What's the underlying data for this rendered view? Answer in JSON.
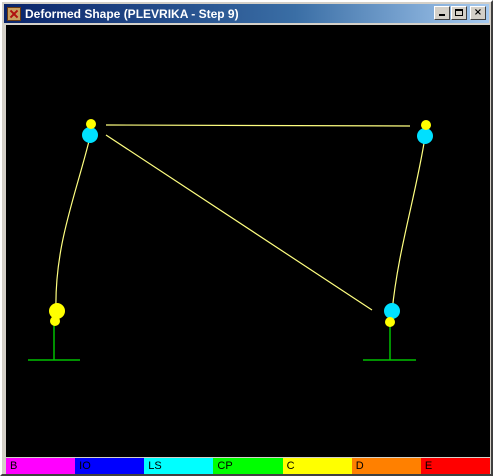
{
  "window": {
    "title": "Deformed Shape (PLEVRIKA - Step 9)",
    "controls": {
      "minimize": "minimize",
      "maximize": "maximize",
      "close": "×"
    }
  },
  "legend": [
    {
      "label": "B",
      "color": "#ff00ff"
    },
    {
      "label": "IO",
      "color": "#0000ff"
    },
    {
      "label": "LS",
      "color": "#00ffff"
    },
    {
      "label": "CP",
      "color": "#00ff00"
    },
    {
      "label": "C",
      "color": "#ffff00"
    },
    {
      "label": "D",
      "color": "#ff8000"
    },
    {
      "label": "E",
      "color": "#ff0000"
    }
  ],
  "colors": {
    "canvas_background": "#000000",
    "member_line": "#ffff80",
    "support_line": "#00c000",
    "hinge_ls": "#00e0ff",
    "hinge_c": "#ffff00"
  }
}
